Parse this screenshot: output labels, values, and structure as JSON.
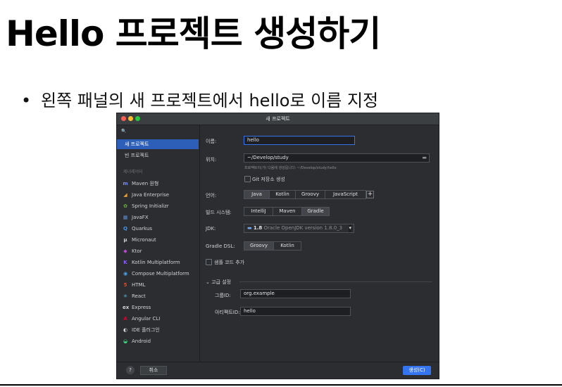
{
  "slide": {
    "title": "Hello 프로젝트 생성하기",
    "bullet": "왼쪽 패널의 새 프로젝트에서 hello로 이름 지정"
  },
  "window": {
    "title": "새 프로젝트"
  },
  "sidebar": {
    "search_icon": "🔍",
    "top_items": [
      {
        "label": "새 프로젝트",
        "selected": true
      },
      {
        "label": "빈 프로젝트",
        "selected": false
      }
    ],
    "section_label": "제너레이터",
    "generators": [
      {
        "label": "Maven 원형",
        "icon": "m",
        "color": "#7a8cf0"
      },
      {
        "label": "Java Enterprise",
        "icon": "◢",
        "color": "#f0a030"
      },
      {
        "label": "Spring Initializr",
        "icon": "✿",
        "color": "#6db33f"
      },
      {
        "label": "JavaFX",
        "icon": "▦",
        "color": "#5d8ccf"
      },
      {
        "label": "Quarkus",
        "icon": "Q",
        "color": "#4695eb"
      },
      {
        "label": "Micronaut",
        "icon": "μ",
        "color": "#cfd2d6"
      },
      {
        "label": "Ktor",
        "icon": "◆",
        "color": "#b84ad6"
      },
      {
        "label": "Kotlin Multiplatform",
        "icon": "K",
        "color": "#8f5cff"
      },
      {
        "label": "Compose Multiplatform",
        "icon": "◉",
        "color": "#4aa3f0"
      },
      {
        "label": "HTML",
        "icon": "5",
        "color": "#e34c26"
      },
      {
        "label": "React",
        "icon": "⚛",
        "color": "#61dafb"
      },
      {
        "label": "Express",
        "icon": "ex",
        "color": "#cfd2d6"
      },
      {
        "label": "Angular CLI",
        "icon": "A",
        "color": "#dd0031"
      },
      {
        "label": "IDE 플러그인",
        "icon": "◐",
        "color": "#cfd2d6"
      },
      {
        "label": "Android",
        "icon": "◒",
        "color": "#3ddc84"
      }
    ]
  },
  "form": {
    "name_label": "이름:",
    "name_value": "hello",
    "location_label": "위치:",
    "location_value": "~/Develop/study",
    "location_hint": "프로젝트이(가) 다음에 생성됩니다: ~/Develop/study/hello",
    "git_label": "Git 저장소 생성",
    "language_label": "언어:",
    "languages": [
      "Java",
      "Kotlin",
      "Groovy",
      "JavaScript"
    ],
    "language_selected": "Java",
    "add_label": "+",
    "build_label": "빌드 시스템:",
    "build_systems": [
      "IntelliJ",
      "Maven",
      "Gradle"
    ],
    "build_selected": "Gradle",
    "jdk_label": "JDK:",
    "jdk_version": "1.8",
    "jdk_name": "Oracle OpenJDK version 1.8.0_3",
    "dsl_label": "Gradle DSL:",
    "dsls": [
      "Groovy",
      "Kotlin"
    ],
    "dsl_selected": "Groovy",
    "sample_label": "샘플 코드 추가",
    "advanced_label": "고급 설정",
    "group_label": "그룹ID:",
    "group_value": "org.example",
    "artifact_label": "아티팩트ID:",
    "artifact_value": "hello"
  },
  "footer": {
    "help_label": "?",
    "cancel_label": "취소",
    "create_label": "생성(C)"
  },
  "colors": {
    "selection": "#2e5fb8",
    "primary_button": "#3574f0",
    "window_bg": "#2b2d30"
  }
}
